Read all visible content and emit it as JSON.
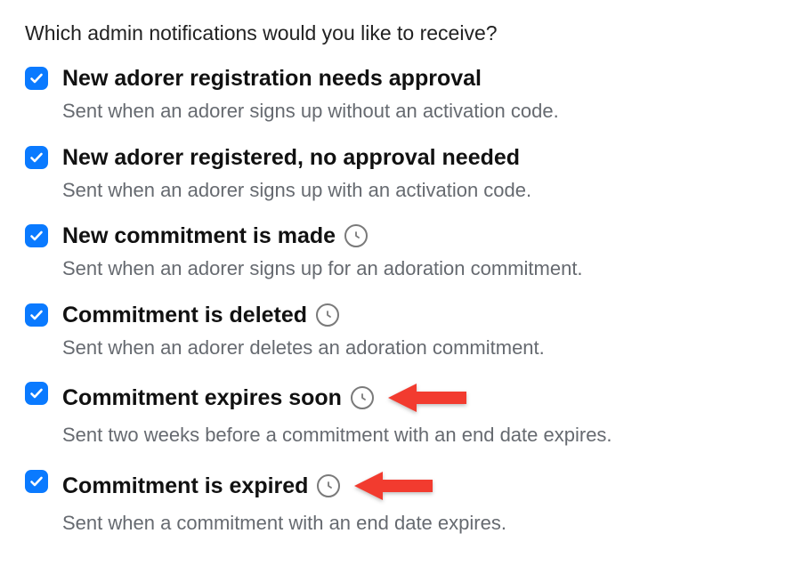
{
  "question": "Which admin notifications would you like to receive?",
  "options": [
    {
      "checked": true,
      "title": "New adorer registration needs approval",
      "desc": "Sent when an adorer signs up without an activation code.",
      "has_clock": false,
      "has_arrow": false
    },
    {
      "checked": true,
      "title": "New adorer registered, no approval needed",
      "desc": "Sent when an adorer signs up with an activation code.",
      "has_clock": false,
      "has_arrow": false
    },
    {
      "checked": true,
      "title": "New commitment is made",
      "desc": "Sent when an adorer signs up for an adoration commitment.",
      "has_clock": true,
      "has_arrow": false
    },
    {
      "checked": true,
      "title": "Commitment is deleted",
      "desc": "Sent when an adorer deletes an adoration commitment.",
      "has_clock": true,
      "has_arrow": false
    },
    {
      "checked": true,
      "title": "Commitment expires soon",
      "desc": "Sent two weeks before a commitment with an end date expires.",
      "has_clock": true,
      "has_arrow": true
    },
    {
      "checked": true,
      "title": "Commitment is expired",
      "desc": "Sent when a commitment with an end date expires.",
      "has_clock": true,
      "has_arrow": true
    }
  ],
  "colors": {
    "checkbox": "#0a7aff",
    "arrow": "#f23b2f",
    "desc": "#666a70"
  }
}
